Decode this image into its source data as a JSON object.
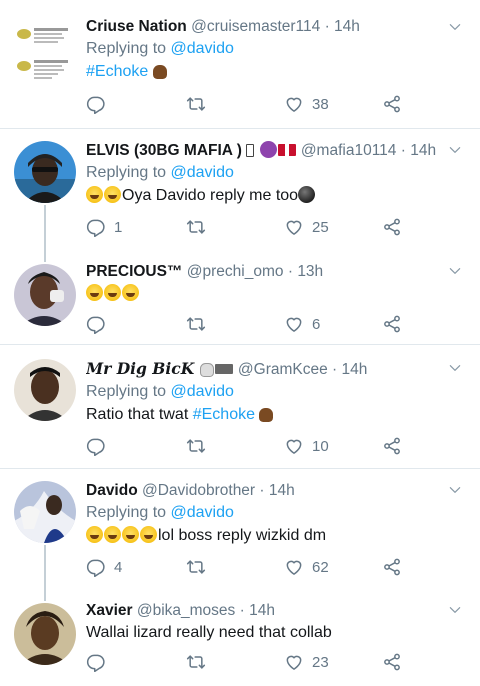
{
  "tweets": [
    {
      "name": "Criuse Nation",
      "handle": "@cruisemaster114",
      "dot": "·",
      "time": "14h",
      "replying_prefix": "Replying to",
      "replying_to": "@davido",
      "text": "#Echoke",
      "replies": "",
      "retweets": "",
      "likes": "38"
    },
    {
      "name": "ELVIS (30BG MAFIA )",
      "handle": "@mafia10114",
      "dot": "·",
      "time": "14h",
      "replying_prefix": "Replying to",
      "replying_to": "@davido",
      "text": "Oya Davido reply me too",
      "replies": "1",
      "retweets": "",
      "likes": "25"
    },
    {
      "name": "PRECIOUS™",
      "handle": "@prechi_omo",
      "dot": "·",
      "time": "13h",
      "replies": "",
      "retweets": "",
      "likes": "6"
    },
    {
      "name": "Mr Dig BicK",
      "handle": "@GramKcee",
      "dot": "·",
      "time": "14h",
      "replying_prefix": "Replying to",
      "replying_to": "@davido",
      "text_plain": "Ratio that twat ",
      "text_tag": "#Echoke",
      "replies": "",
      "retweets": "",
      "likes": "10"
    },
    {
      "name": "Davido",
      "handle": "@Davidobrother",
      "dot": "·",
      "time": "14h",
      "replying_prefix": "Replying to",
      "replying_to": "@davido",
      "text": "lol boss reply wizkid dm",
      "replies": "4",
      "retweets": "",
      "likes": "62"
    },
    {
      "name": "Xavier",
      "handle": "@bika_moses",
      "dot": "·",
      "time": "14h",
      "text": "Wallai lizard really need that collab",
      "replies": "",
      "retweets": "",
      "likes": "23"
    }
  ],
  "colors": {
    "link": "#1da1f2",
    "muted": "#657786",
    "divider": "#e1e8ed"
  },
  "icons": [
    "chevron-down-icon",
    "reply-icon",
    "retweet-icon",
    "like-icon",
    "share-icon"
  ]
}
